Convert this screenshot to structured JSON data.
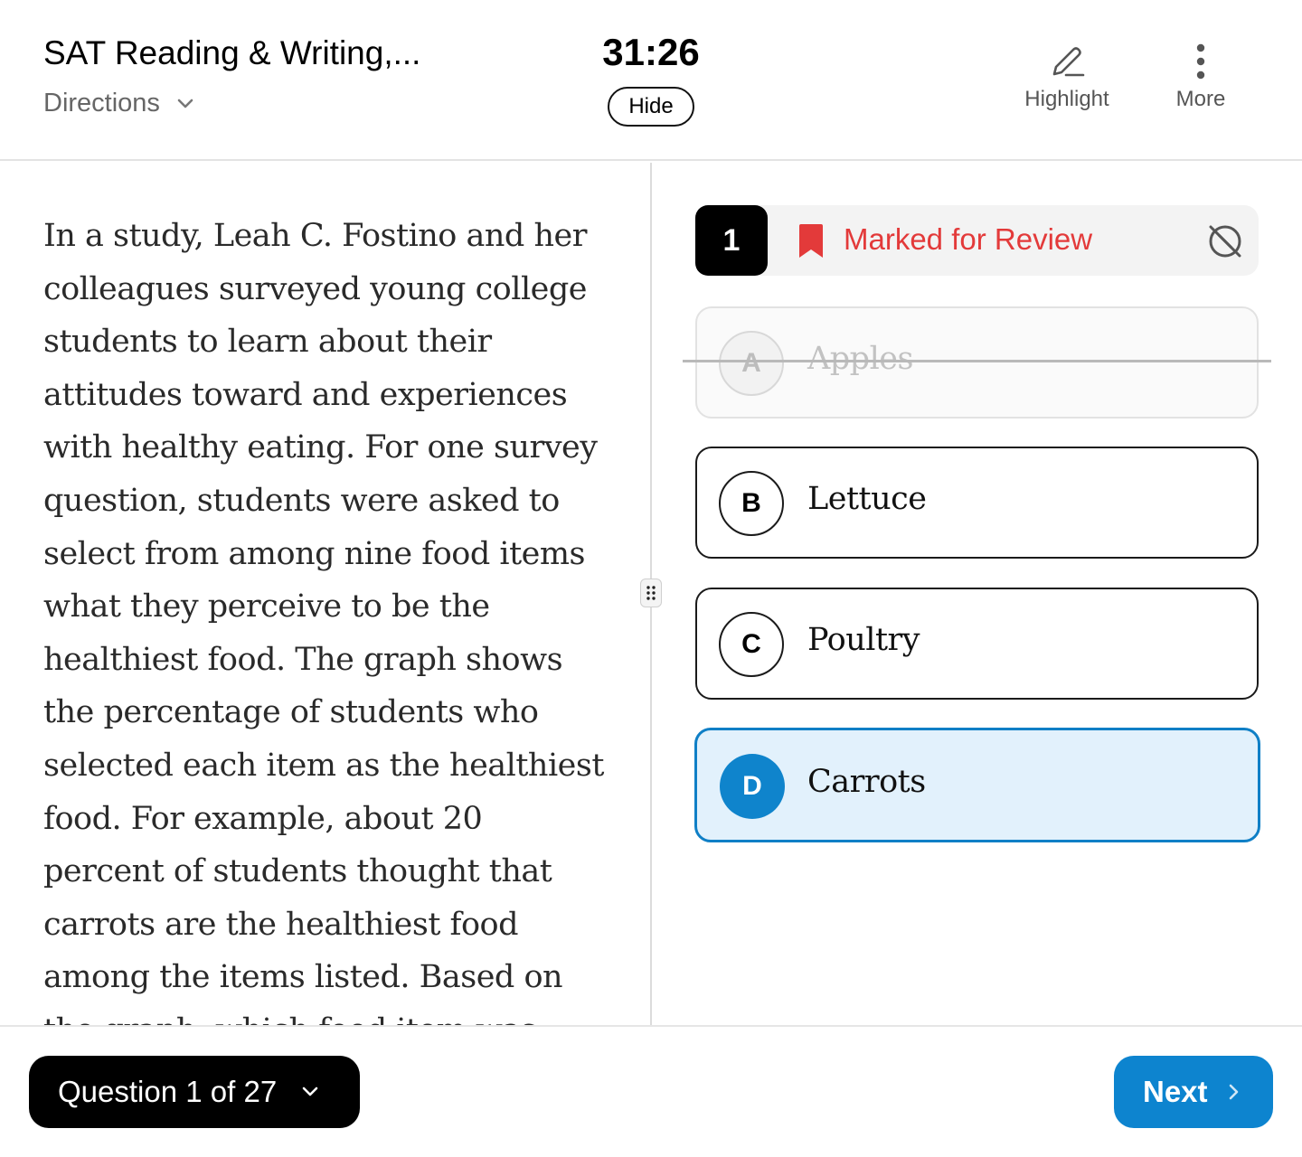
{
  "header": {
    "title": "SAT Reading & Writing,...",
    "directions_label": "Directions",
    "timer": "31:26",
    "hide_label": "Hide",
    "tools": {
      "highlight_label": "Highlight",
      "more_label": "More"
    }
  },
  "passage": {
    "text": "In a study, Leah C. Fostino and her colleagues surveyed young college students to learn about their attitudes toward and experiences with healthy eating. For one survey question, students were asked to select from among nine food items what they perceive to be the healthiest food. The graph shows the percentage of students who selected each item as the healthiest food. For example, about 20 percent of students thought that carrots are the healthiest food among the items listed. Based on the graph, which food item was selected by the highest percentage of students as the healthiest food?"
  },
  "question": {
    "number": "1",
    "marked_label": "Marked for Review",
    "choices": [
      {
        "letter": "A",
        "text": "Apples",
        "state": "eliminated"
      },
      {
        "letter": "B",
        "text": "Lettuce",
        "state": "default"
      },
      {
        "letter": "C",
        "text": "Poultry",
        "state": "default"
      },
      {
        "letter": "D",
        "text": "Carrots",
        "state": "selected"
      }
    ]
  },
  "footer": {
    "question_nav_label": "Question 1 of 27",
    "next_label": "Next"
  },
  "colors": {
    "marked_red": "#e33a3a",
    "selected_blue": "#0f84cc",
    "selected_bg": "#e2f1fc",
    "next_blue": "#0d84cf"
  },
  "icons": {
    "directions": "chevron-down-icon",
    "highlight": "pencil-icon",
    "more": "vertical-dots-icon",
    "marked": "bookmark-icon",
    "eliminate": "eliminate-toggle-icon",
    "drag": "drag-handle-icon",
    "nav": "chevron-down-icon",
    "next": "chevron-right-icon"
  }
}
